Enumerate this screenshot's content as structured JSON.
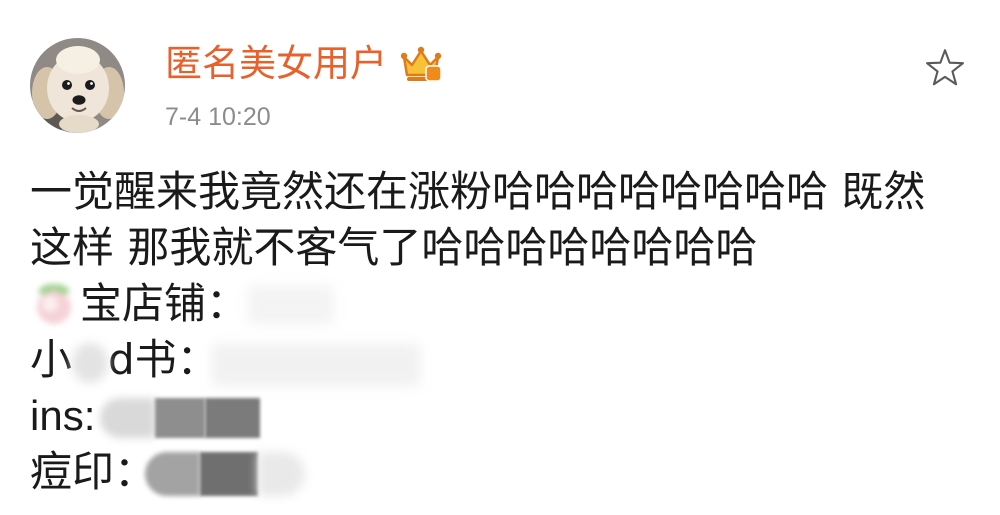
{
  "post": {
    "author": {
      "name": "匿名美女用户",
      "avatar_icon": "dog-avatar-image",
      "badge_icon": "vip-crown-icon"
    },
    "timestamp": "7-4 10:20",
    "favorite_icon": "star-outline-icon",
    "text_lines": [
      "一觉醒来我竟然还在涨粉哈哈哈哈哈哈哈哈 既然",
      "这样 那我就不客气了哈哈哈哈哈哈哈哈"
    ],
    "links": [
      {
        "icon": "peach-emoji-icon",
        "label": "宝店铺："
      },
      {
        "label_prefix": "小",
        "label_suffix": "d书："
      },
      {
        "label": "ins:"
      },
      {
        "label": "痘印："
      }
    ]
  },
  "colors": {
    "author_name": "#e8612c",
    "text": "#1a1a1a",
    "timestamp": "#8c8c8c",
    "icon_stroke": "#5a5a5a",
    "crown_gold": "#f7c23a",
    "crown_orange": "#e07b1a",
    "background": "#ffffff"
  }
}
